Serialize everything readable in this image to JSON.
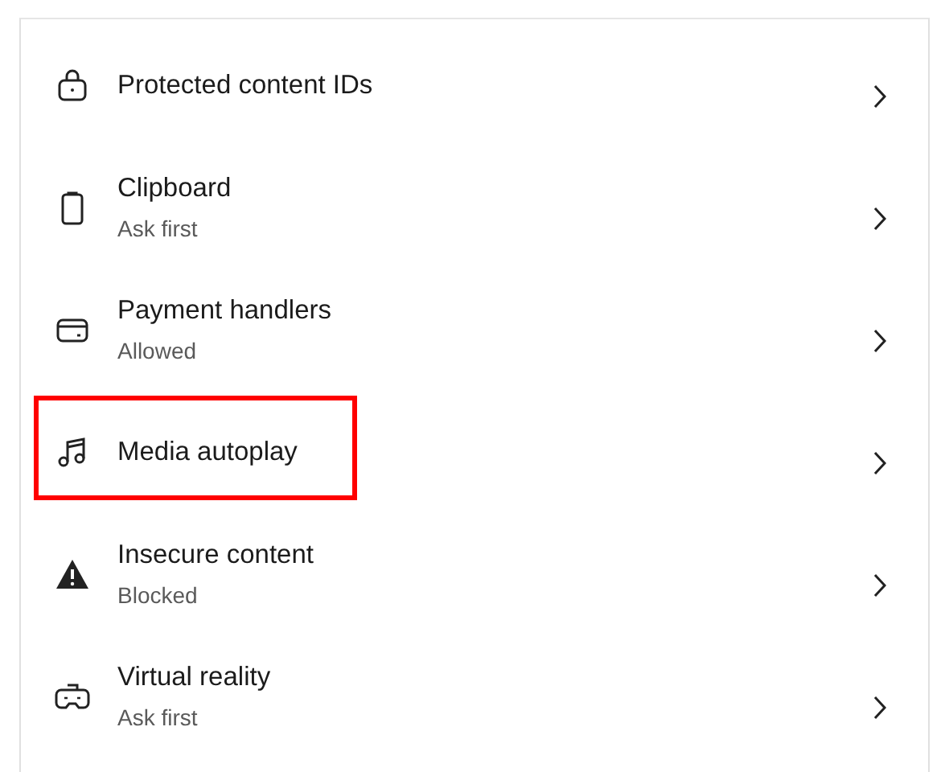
{
  "settings_list": [
    {
      "title": "Protected content IDs",
      "highlighted": false
    },
    {
      "title": "Clipboard",
      "subtitle": "Ask first",
      "highlighted": false
    },
    {
      "title": "Payment handlers",
      "subtitle": "Allowed",
      "highlighted": false
    },
    {
      "title": "Media autoplay",
      "highlighted": true
    },
    {
      "title": "Insecure content",
      "subtitle": "Blocked",
      "highlighted": false
    },
    {
      "title": "Virtual reality",
      "subtitle": "Ask first",
      "highlighted": false
    }
  ]
}
